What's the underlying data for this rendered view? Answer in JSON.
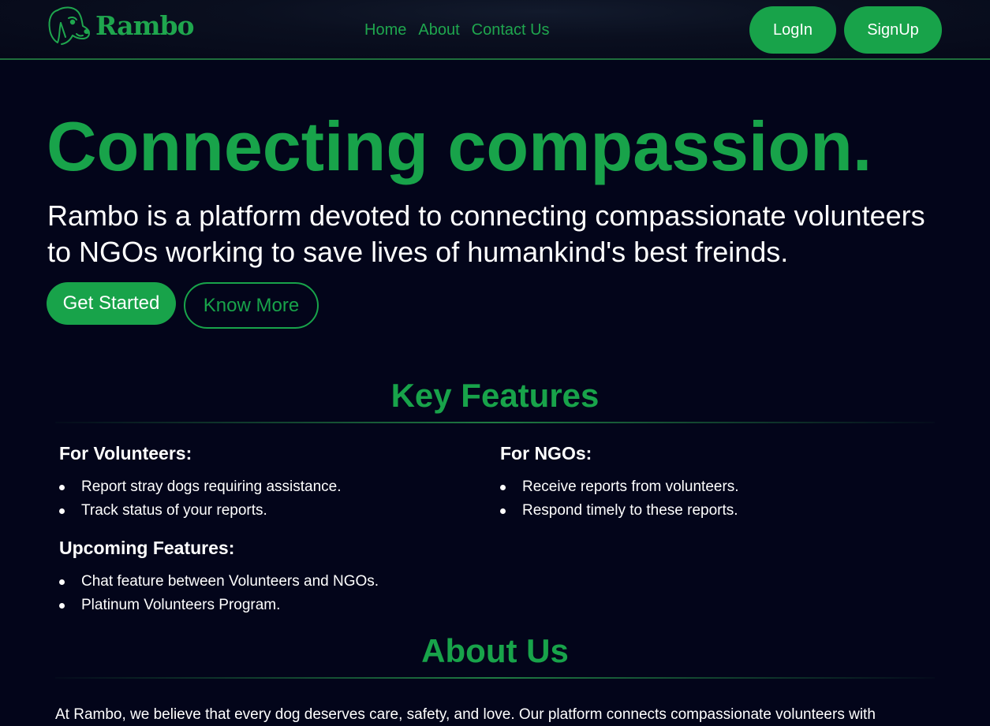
{
  "brand": {
    "name": "Rambo",
    "logo_icon": "dog-head-icon"
  },
  "nav": {
    "links": [
      "Home",
      "About",
      "Contact Us"
    ],
    "login_label": "LogIn",
    "signup_label": "SignUp"
  },
  "hero": {
    "title": "Connecting compassion.",
    "subtitle": "Rambo is a platform devoted to connecting compassionate volunteers to NGOs working to save lives of humankind's best freinds.",
    "primary_cta": "Get Started",
    "secondary_cta": "Know More"
  },
  "features": {
    "title": "Key Features",
    "volunteers": {
      "heading": "For Volunteers:",
      "items": [
        "Report stray dogs requiring assistance.",
        "Track status of your reports."
      ]
    },
    "ngos": {
      "heading": "For NGOs:",
      "items": [
        "Receive reports from volunteers.",
        "Respond timely to these reports."
      ]
    },
    "upcoming": {
      "heading": "Upcoming Features:",
      "items": [
        "Chat feature between Volunteers and NGOs.",
        "Platinum Volunteers Program."
      ]
    }
  },
  "about": {
    "title": "About Us",
    "text": "At Rambo, we believe that every dog deserves care, safety, and love. Our platform connects compassionate volunteers with"
  },
  "colors": {
    "background": "#03051a",
    "accent": "#18a34a",
    "text": "#ffffff"
  }
}
